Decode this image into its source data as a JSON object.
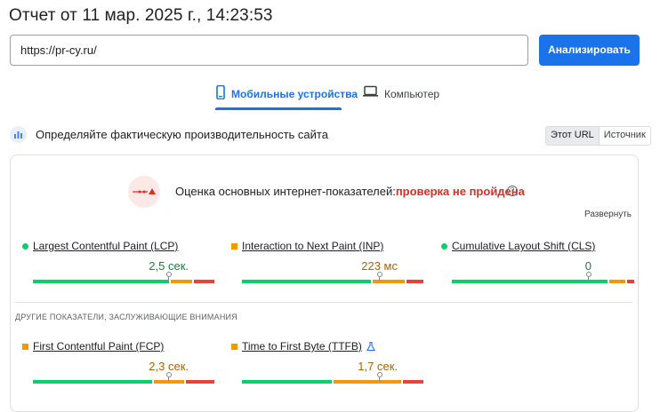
{
  "header": {
    "title": "Отчет от 11 мар. 2025 г., 14:23:53"
  },
  "search": {
    "url_value": "https://pr-cy.ru/",
    "analyze_label": "Анализировать"
  },
  "tabs": [
    {
      "label": "Мобильные устройства",
      "icon": "smartphone-icon",
      "active": true
    },
    {
      "label": "Компьютер",
      "icon": "laptop-icon",
      "active": false
    }
  ],
  "field_data": {
    "heading": "Определяйте фактическую производительность сайта",
    "toggle": {
      "this_url": "Этот URL",
      "origin": "Источник"
    },
    "assessment": {
      "label": "Оценка основных интернет-показателей:",
      "status": "проверка не пройдена"
    },
    "expand_label": "Развернуть",
    "core_metrics": [
      {
        "name": "Largest Contentful Paint (LCP)",
        "value": "2,5 сек.",
        "rating": "good",
        "distribution": {
          "good": 0.75,
          "needs_improvement": 0.14,
          "poor": 0.11
        },
        "marker": 0.75
      },
      {
        "name": "Interaction to Next Paint (INP)",
        "value": "223 мс",
        "rating": "needs-improvement",
        "distribution": {
          "good": 0.72,
          "needs_improvement": 0.18,
          "poor": 0.1
        },
        "marker": 0.75
      },
      {
        "name": "Cumulative Layout Shift (CLS)",
        "value": "0",
        "rating": "good",
        "distribution": {
          "good": 0.85,
          "needs_improvement": 0.1,
          "poor": 0.05
        },
        "marker": 0.75
      }
    ],
    "other_heading": "ДРУГИЕ ПОКАЗАТЕЛИ, ЗАСЛУЖИВАЮЩИЕ ВНИМАНИЯ",
    "other_metrics": [
      {
        "name": "First Contentful Paint (FCP)",
        "value": "2,3 сек.",
        "rating": "needs-improvement",
        "distribution": {
          "good": 0.66,
          "needs_improvement": 0.17,
          "poor": 0.17
        },
        "marker": 0.75
      },
      {
        "name": "Time to First Byte (TTFB)",
        "value": "1,7 сек.",
        "rating": "needs-improvement",
        "distribution": {
          "good": 0.5,
          "needs_improvement": 0.38,
          "poor": 0.12
        },
        "marker": 0.75,
        "experimental_icon": "flask-icon"
      }
    ]
  },
  "colors": {
    "accent": "#1a73e8",
    "good": "#0cce6b",
    "average": "#f29900",
    "poor": "#ea4335",
    "fail_text": "#d93025"
  }
}
